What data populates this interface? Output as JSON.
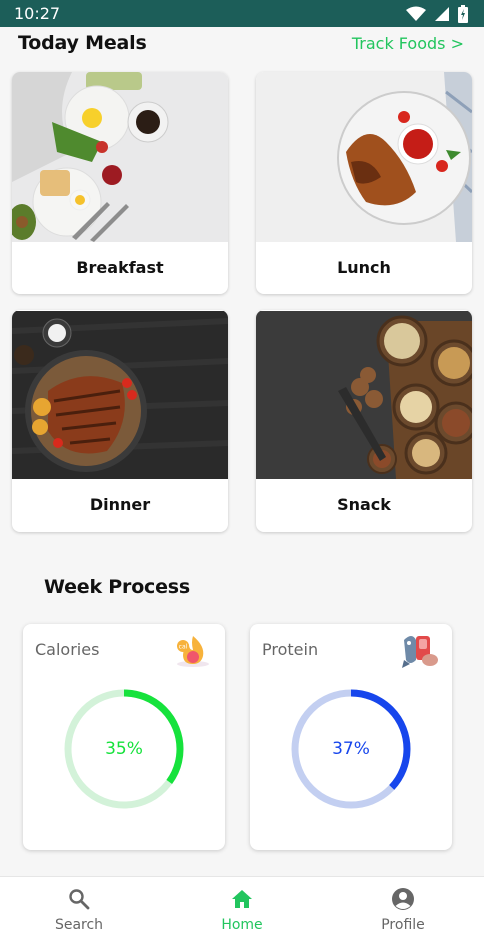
{
  "status_bar": {
    "time": "10:27"
  },
  "today_meals": {
    "title": "Today Meals",
    "track_link": "Track Foods >",
    "meals": [
      {
        "label": "Breakfast"
      },
      {
        "label": "Lunch"
      },
      {
        "label": "Dinner"
      },
      {
        "label": "Snack"
      }
    ]
  },
  "week_process": {
    "title": "Week Process",
    "stats": [
      {
        "label": "Calories",
        "percent_text": "35%",
        "progress": 0.35,
        "color": "#16e23c",
        "track_color": "#d3f2d9",
        "icon": "calorie-fire-icon"
      },
      {
        "label": "Protein",
        "percent_text": "37%",
        "progress": 0.37,
        "color": "#1746ec",
        "track_color": "#c3cff1",
        "icon": "protein-fish-meat-icon"
      }
    ]
  },
  "bottom_nav": {
    "items": [
      {
        "label": "Search",
        "icon": "search-icon",
        "active": false
      },
      {
        "label": "Home",
        "icon": "home-icon",
        "active": true
      },
      {
        "label": "Profile",
        "icon": "profile-icon",
        "active": false
      }
    ],
    "active_color": "#22c55e",
    "inactive_color": "#666666"
  }
}
